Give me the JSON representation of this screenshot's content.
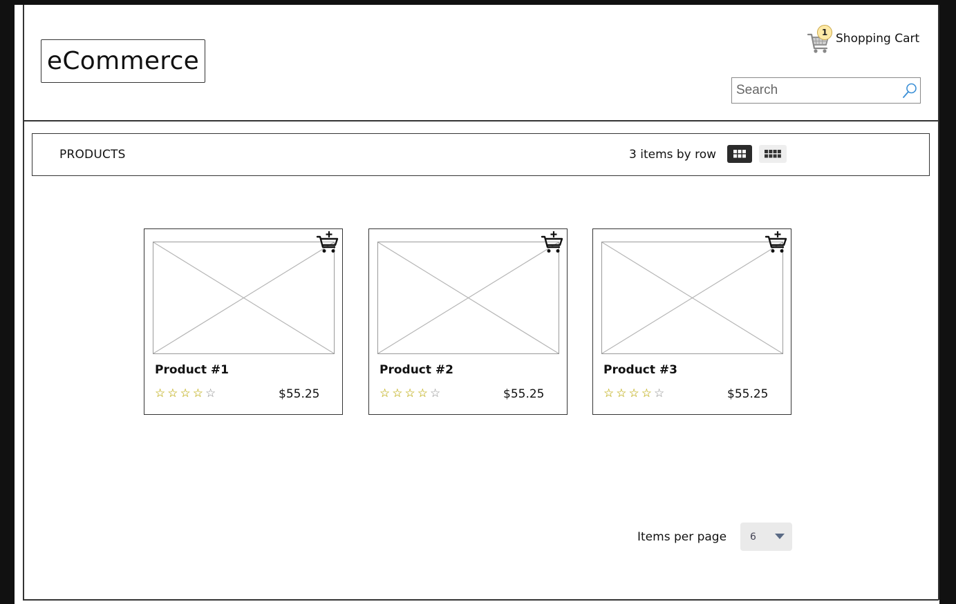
{
  "header": {
    "logo": "eCommerce",
    "cart": {
      "label": "Shopping Cart",
      "count": "1"
    },
    "search": {
      "placeholder": "Search"
    }
  },
  "toolbar": {
    "title": "PRODUCTS",
    "rows_label": "3 items by row",
    "views": [
      {
        "name": "3-per-row",
        "active": true
      },
      {
        "name": "4-per-row",
        "active": false
      }
    ]
  },
  "products": [
    {
      "name": "Product #1",
      "price": "$55.25",
      "rating": 4,
      "max_rating": 5
    },
    {
      "name": "Product #2",
      "price": "$55.25",
      "rating": 4,
      "max_rating": 5
    },
    {
      "name": "Product #3",
      "price": "$55.25",
      "rating": 4,
      "max_rating": 5
    }
  ],
  "pagination": {
    "items_per_page_label": "Items per page",
    "items_per_page_value": "6"
  },
  "colors": {
    "star_filled": "#d9c200",
    "star_empty": "#888888",
    "cart_badge": "#fde9a6",
    "search_icon": "#3a8fd6",
    "active_view": "#2b2b2b"
  },
  "icons": {
    "cart": "shopping-cart-icon",
    "search": "magnifier-icon",
    "add_to_cart": "add-to-cart-icon",
    "grid3": "grid-3-icon",
    "grid4": "grid-4-icon",
    "dropdown": "chevron-down-icon"
  }
}
